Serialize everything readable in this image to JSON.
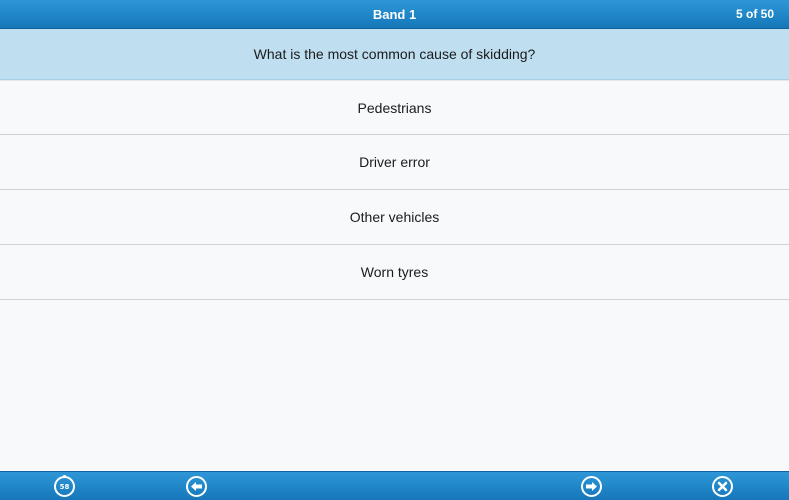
{
  "header": {
    "title": "Band 1",
    "counter": "5 of 50"
  },
  "question": {
    "text": "What is the most common cause of skidding?"
  },
  "answers": [
    {
      "label": "Pedestrians"
    },
    {
      "label": "Driver error"
    },
    {
      "label": "Other vehicles"
    },
    {
      "label": "Worn tyres"
    }
  ],
  "footer": {
    "timer_value": "58",
    "buttons": [
      "timer-icon",
      "arrow-left-icon",
      "arrow-right-icon",
      "close-icon"
    ]
  },
  "colors": {
    "bar_blue": "#1f86c8",
    "question_bg": "#bfdff1",
    "page_bg": "#f8f9fb"
  }
}
